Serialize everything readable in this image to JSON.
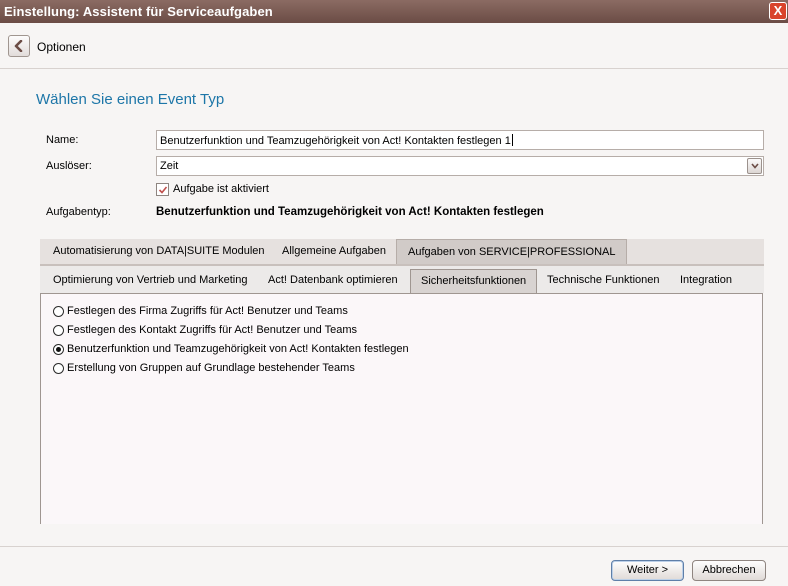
{
  "window": {
    "title": "Einstellung: Assistent für Serviceaufgaben",
    "close_label": "X"
  },
  "nav": {
    "back_icon": "chevron-left-icon",
    "label": "Optionen"
  },
  "heading": "Wählen Sie einen Event Typ",
  "form": {
    "name_label": "Name:",
    "name_value": "Benutzerfunktion und Teamzugehörigkeit von Act! Kontakten festlegen 1",
    "trigger_label": "Auslöser:",
    "trigger_value": "Zeit",
    "active_checkbox_label": "Aufgabe ist aktiviert",
    "active_checked": true,
    "type_label": "Aufgabentyp:",
    "type_value": "Benutzerfunktion und Teamzugehörigkeit von Act! Kontakten festlegen"
  },
  "tabs_level1": [
    {
      "label": "Automatisierung von DATA|SUITE Modulen",
      "active": false
    },
    {
      "label": "Allgemeine Aufgaben",
      "active": false
    },
    {
      "label": "Aufgaben von SERVICE|PROFESSIONAL",
      "active": true
    }
  ],
  "tabs_level2": [
    {
      "label": "Optimierung von Vertrieb und Marketing",
      "active": false
    },
    {
      "label": "Act! Datenbank optimieren",
      "active": false
    },
    {
      "label": "Sicherheitsfunktionen",
      "active": true
    },
    {
      "label": "Technische Funktionen",
      "active": false
    },
    {
      "label": "Integration",
      "active": false
    }
  ],
  "options": [
    {
      "label": "Festlegen des Firma Zugriffs für Act! Benutzer und Teams",
      "selected": false
    },
    {
      "label": "Festlegen des Kontakt Zugriffs für Act! Benutzer und Teams",
      "selected": false
    },
    {
      "label": "Benutzerfunktion und Teamzugehörigkeit von Act! Kontakten festlegen",
      "selected": true
    },
    {
      "label": "Erstellung von Gruppen auf Grundlage bestehender Teams",
      "selected": false
    }
  ],
  "footer": {
    "next_label": "Weiter >",
    "cancel_label": "Abbrechen"
  },
  "colors": {
    "titlebar": "#7a5b54",
    "heading": "#1d76a8",
    "close": "#d9442c"
  }
}
